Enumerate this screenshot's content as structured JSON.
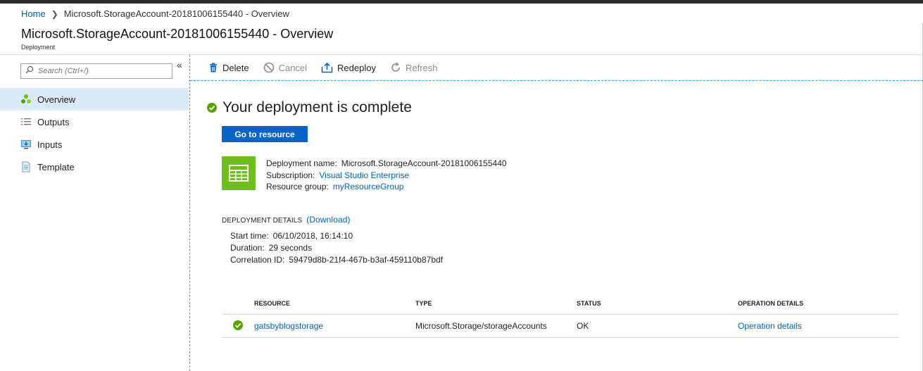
{
  "breadcrumb": {
    "home": "Home",
    "current": "Microsoft.StorageAccount-20181006155440 - Overview"
  },
  "header": {
    "title": "Microsoft.StorageAccount-20181006155440 - Overview",
    "subtitle": "Deployment"
  },
  "sidebar": {
    "search_placeholder": "Search (Ctrl+/)",
    "collapse_glyph": "«",
    "items": [
      {
        "label": "Overview",
        "icon": "overview-icon"
      },
      {
        "label": "Outputs",
        "icon": "list-icon"
      },
      {
        "label": "Inputs",
        "icon": "monitor-icon"
      },
      {
        "label": "Template",
        "icon": "document-icon"
      }
    ]
  },
  "toolbar": {
    "delete": "Delete",
    "cancel": "Cancel",
    "redeploy": "Redeploy",
    "refresh": "Refresh"
  },
  "main": {
    "status_title": "Your deployment is complete",
    "goto_button": "Go to resource",
    "deployment_name_label": "Deployment name:",
    "deployment_name": "Microsoft.StorageAccount-20181006155440",
    "subscription_label": "Subscription:",
    "subscription": "Visual Studio Enterprise",
    "resource_group_label": "Resource group:",
    "resource_group": "myResourceGroup",
    "details_header": "DEPLOYMENT DETAILS",
    "download_link": "(Download)",
    "start_time_label": "Start time:",
    "start_time": "06/10/2018, 16:14:10",
    "duration_label": "Duration:",
    "duration": "29 seconds",
    "correlation_label": "Correlation ID:",
    "correlation_id": "59479d8b-21f4-467b-b3af-459110b87bdf"
  },
  "table": {
    "headers": [
      "RESOURCE",
      "TYPE",
      "STATUS",
      "OPERATION DETAILS"
    ],
    "rows": [
      {
        "resource": "gatsbyblogstorage",
        "type": "Microsoft.Storage/storageAccounts",
        "status": "OK",
        "operation": "Operation details"
      }
    ]
  },
  "colors": {
    "accent": "#0a64c8",
    "success": "#57a300",
    "link": "#0062ad",
    "active_nav": "#dbeaf8",
    "resource_tile": "#6ebe1e"
  }
}
